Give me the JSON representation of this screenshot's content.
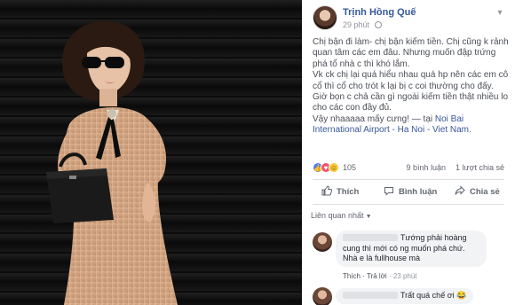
{
  "post": {
    "author": "Trịnh Hồng Quế",
    "time": "29 phút",
    "privacy_icon": "globe-icon",
    "menu_icon": "chevron-down-icon",
    "paragraphs": [
      "Chị bận đi làm- chị bận kiếm tiền. Chị cũng k rảnh quan tâm các em đâu. Nhưng muốn đập trứng phá tổ nhà c thì khó lắm.",
      "Vk ck chị lại quá hiểu nhau quá hp nên các em cô cổ thì cổ cho trót k lại bị c coi thường cho đấy.",
      "Giờ bọn c chả cần gì ngoài kiếm tiền thật nhiều lo cho các con đầy đủ.",
      "Vậy nhaaaaa mấy cưng!"
    ],
    "location_prefix": " — tại ",
    "location": "Noi Bai International Airport - Ha Noi - Viet Nam",
    "location_suffix": "."
  },
  "stats": {
    "reaction_count": "105",
    "comments": "9 bình luận",
    "shares": "1 lượt chia sẻ"
  },
  "actions": {
    "like": "Thích",
    "comment": "Bình luận",
    "share": "Chia sẻ"
  },
  "related_label": "Liên quan nhất",
  "comments": [
    {
      "text": "Tướng phải hoàng cung thì mới có ng muốn phá chứ. Nhà e là fullhouse mà",
      "like": "Thích",
      "reply": "Trả lời",
      "time": "23 phút"
    },
    {
      "text": "Trất quá chế ơi 😂"
    }
  ],
  "colors": {
    "link": "#365899",
    "like_reaction": "#4e7cf4",
    "love_reaction": "#f25268",
    "haha_reaction": "#f7c936"
  }
}
